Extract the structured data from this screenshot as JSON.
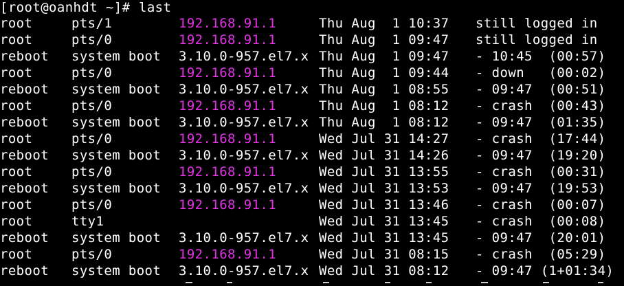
{
  "terminal": {
    "prompt": "[root@oanhdt ~]#",
    "command": "last",
    "colors": {
      "background": "#000000",
      "text": "#ffffff",
      "ip": "#e233e6"
    }
  },
  "rows": [
    {
      "user": "root",
      "tty": "pts/1",
      "host": "192.168.91.1",
      "host_is_ip": true,
      "login": "Thu Aug  1 10:37",
      "status": "still logged in"
    },
    {
      "user": "root",
      "tty": "pts/0",
      "host": "192.168.91.1",
      "host_is_ip": true,
      "login": "Thu Aug  1 09:47",
      "status": "still logged in"
    },
    {
      "user": "reboot",
      "tty": "system boot",
      "host": "3.10.0-957.el7.x",
      "host_is_ip": false,
      "login": "Thu Aug  1 09:47",
      "status": "- 10:45  (00:57)"
    },
    {
      "user": "root",
      "tty": "pts/0",
      "host": "192.168.91.1",
      "host_is_ip": true,
      "login": "Thu Aug  1 09:44",
      "status": "- down   (00:02)"
    },
    {
      "user": "reboot",
      "tty": "system boot",
      "host": "3.10.0-957.el7.x",
      "host_is_ip": false,
      "login": "Thu Aug  1 08:55",
      "status": "- 09:47  (00:51)"
    },
    {
      "user": "root",
      "tty": "pts/0",
      "host": "192.168.91.1",
      "host_is_ip": true,
      "login": "Thu Aug  1 08:12",
      "status": "- crash  (00:43)"
    },
    {
      "user": "reboot",
      "tty": "system boot",
      "host": "3.10.0-957.el7.x",
      "host_is_ip": false,
      "login": "Thu Aug  1 08:12",
      "status": "- 09:47  (01:35)"
    },
    {
      "user": "root",
      "tty": "pts/0",
      "host": "192.168.91.1",
      "host_is_ip": true,
      "login": "Wed Jul 31 14:27",
      "status": "- crash  (17:44)"
    },
    {
      "user": "reboot",
      "tty": "system boot",
      "host": "3.10.0-957.el7.x",
      "host_is_ip": false,
      "login": "Wed Jul 31 14:26",
      "status": "- 09:47  (19:20)"
    },
    {
      "user": "root",
      "tty": "pts/0",
      "host": "192.168.91.1",
      "host_is_ip": true,
      "login": "Wed Jul 31 13:55",
      "status": "- crash  (00:31)"
    },
    {
      "user": "reboot",
      "tty": "system boot",
      "host": "3.10.0-957.el7.x",
      "host_is_ip": false,
      "login": "Wed Jul 31 13:53",
      "status": "- 09:47  (19:53)"
    },
    {
      "user": "root",
      "tty": "pts/0",
      "host": "192.168.91.1",
      "host_is_ip": true,
      "login": "Wed Jul 31 13:46",
      "status": "- crash  (00:07)"
    },
    {
      "user": "root",
      "tty": "tty1",
      "host": "",
      "host_is_ip": false,
      "login": "Wed Jul 31 13:45",
      "status": "- crash  (00:08)"
    },
    {
      "user": "reboot",
      "tty": "system boot",
      "host": "3.10.0-957.el7.x",
      "host_is_ip": false,
      "login": "Wed Jul 31 13:45",
      "status": "- 09:47  (20:01)"
    },
    {
      "user": "root",
      "tty": "pts/0",
      "host": "192.168.91.1",
      "host_is_ip": true,
      "login": "Wed Jul 31 08:15",
      "status": "- crash  (05:29)"
    },
    {
      "user": "reboot",
      "tty": "system boot",
      "host": "3.10.0-957.el7.x",
      "host_is_ip": false,
      "login": "Wed Jul 31 08:12",
      "status": "- 09:47 (1+01:34)"
    }
  ]
}
